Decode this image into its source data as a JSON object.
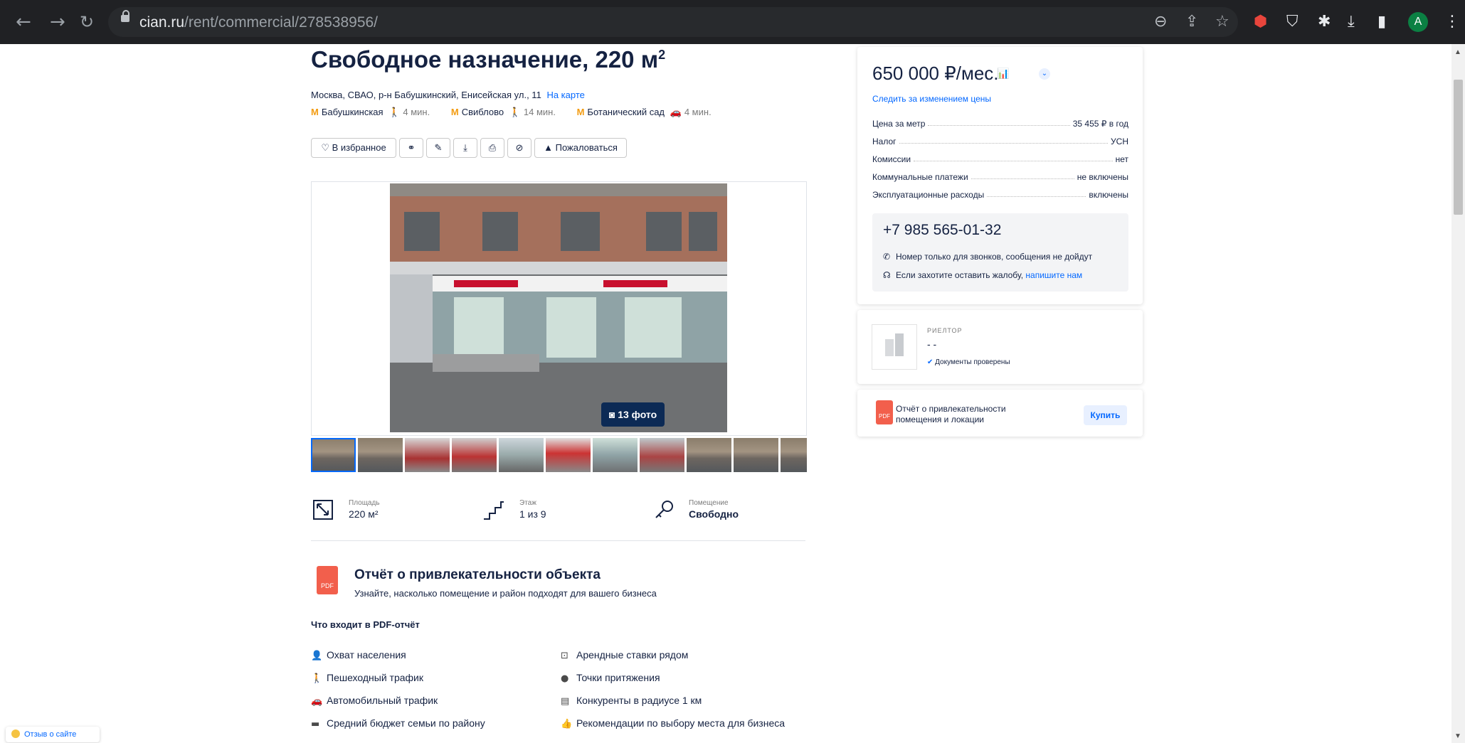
{
  "browser": {
    "url_host": "cian.ru",
    "url_path": "/rent/commercial/278538956/",
    "avatar_letter": "A"
  },
  "listing": {
    "title": "Свободное назначение, 220 м",
    "title_sup": "2",
    "address": "Москва, СВАО, р-н Бабушкинский, Енисейская ул., 11",
    "map_link": "На карте",
    "metro": [
      {
        "name": "Бабушкинская",
        "time": "4 мин.",
        "mode": "walk"
      },
      {
        "name": "Свиблово",
        "time": "14 мин.",
        "mode": "walk"
      },
      {
        "name": "Ботанический сад",
        "time": "4 мин.",
        "mode": "car"
      }
    ],
    "actions": {
      "favorite": "В избранное",
      "complain": "Пожаловаться"
    },
    "photo_count": "13 фото",
    "features": [
      {
        "label": "Площадь",
        "value": "220 м²"
      },
      {
        "label": "Этаж",
        "value": "1 из 9"
      },
      {
        "label": "Помещение",
        "value": "Свободно"
      }
    ]
  },
  "report": {
    "title": "Отчёт о привлекательности объекта",
    "subtitle": "Узнайте, насколько помещение и район подходят для вашего бизнеса",
    "pdf_label": "PDF",
    "includes_heading": "Что входит в PDF-отчёт",
    "items_left": [
      "Охват населения",
      "Пешеходный трафик",
      "Автомобильный трафик",
      "Средний бюджет семьи по району"
    ],
    "items_right": [
      "Арендные ставки рядом",
      "Точки притяжения",
      "Конкуренты в радиусе 1 км",
      "Рекомендации по выбору места для бизнеса"
    ]
  },
  "price_card": {
    "price": "650 000 ₽/мес.",
    "follow": "Следить за изменением цены",
    "rows": [
      {
        "k": "Цена за метр",
        "v": "35 455 ₽ в год"
      },
      {
        "k": "Налог",
        "v": "УСН"
      },
      {
        "k": "Комиссии",
        "v": "нет"
      },
      {
        "k": "Коммунальные платежи",
        "v": "не включены"
      },
      {
        "k": "Эксплуатационные расходы",
        "v": "включены"
      }
    ],
    "phone": "+7 985 565-01-32",
    "note_calls": "Номер только для звонков, сообщения не дойдут",
    "note_complain": "Если захотите оставить жалобу,",
    "note_complain_link": "напишите нам"
  },
  "realtor": {
    "role": "РИЕЛТОР",
    "name": "- -",
    "verified": "Документы проверены"
  },
  "buy_card": {
    "text_line1": "Отчёт о привлекательности",
    "text_line2": "помещения и локации",
    "pdf_label": "PDF",
    "button": "Купить"
  },
  "feedback": {
    "label": "Отзыв о сайте"
  },
  "colors": {
    "accent": "#0468ff",
    "text": "#152242",
    "metro": "#f39c12",
    "pdf": "#f25f4c"
  }
}
